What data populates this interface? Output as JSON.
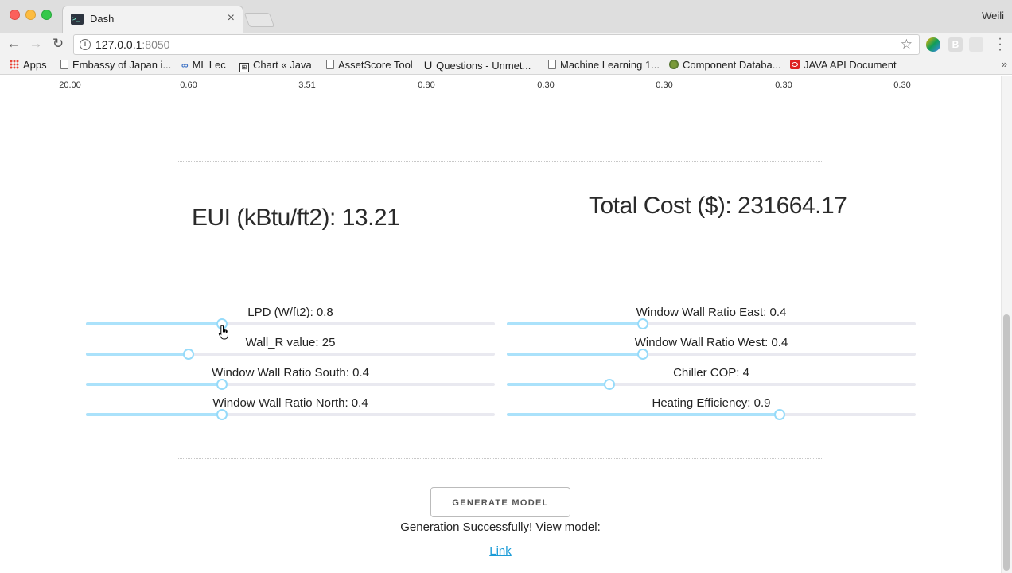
{
  "browser": {
    "tab_title": "Dash",
    "tab_close": "×",
    "profile_name": "Weili",
    "url_host": "127.0.0.1",
    "url_port": ":8050",
    "bookmarks": [
      {
        "label": "Apps",
        "icon": "apps-icon"
      },
      {
        "label": "Embassy of Japan i...",
        "icon": "doc-icon"
      },
      {
        "label": "ML Lec",
        "icon": "cc-icon"
      },
      {
        "label": "Chart « Java",
        "icon": "chart-icon"
      },
      {
        "label": "AssetScore Tool",
        "icon": "doc-icon"
      },
      {
        "label": "Questions - Unmet...",
        "icon": "u-icon"
      },
      {
        "label": "Machine Learning 1...",
        "icon": "doc-icon"
      },
      {
        "label": "Component Databa...",
        "icon": "globe-icon"
      },
      {
        "label": "JAVA API Document",
        "icon": "oracle-icon"
      }
    ],
    "bookmarks_more": "»"
  },
  "table_row": [
    "20.00",
    "0.60",
    "3.51",
    "0.80",
    "0.30",
    "0.30",
    "0.30",
    "0.30"
  ],
  "metrics": {
    "eui": "EUI (kBtu/ft2): 13.21",
    "total_cost": "Total Cost ($): 231664.17"
  },
  "sliders": [
    {
      "label": "LPD (W/ft2): 0.8",
      "value_fraction": 0.333
    },
    {
      "label": "Window Wall Ratio East: 0.4",
      "value_fraction": 0.333
    },
    {
      "label": "Wall_R value: 25",
      "value_fraction": 0.25
    },
    {
      "label": "Window Wall Ratio West: 0.4",
      "value_fraction": 0.333
    },
    {
      "label": "Window Wall Ratio South: 0.4",
      "value_fraction": 0.333
    },
    {
      "label": "Chiller COP: 4",
      "value_fraction": 0.25
    },
    {
      "label": "Window Wall Ratio North: 0.4",
      "value_fraction": 0.333
    },
    {
      "label": "Heating Efficiency: 0.9",
      "value_fraction": 0.667
    }
  ],
  "generate": {
    "button_label": "GENERATE MODEL",
    "status": "Generation Successfully! View model:",
    "link_label": "Link"
  },
  "colors": {
    "slider_track": "#abe2fb",
    "slider_handle_border": "#96dbfa",
    "link": "#1a9bd7"
  }
}
